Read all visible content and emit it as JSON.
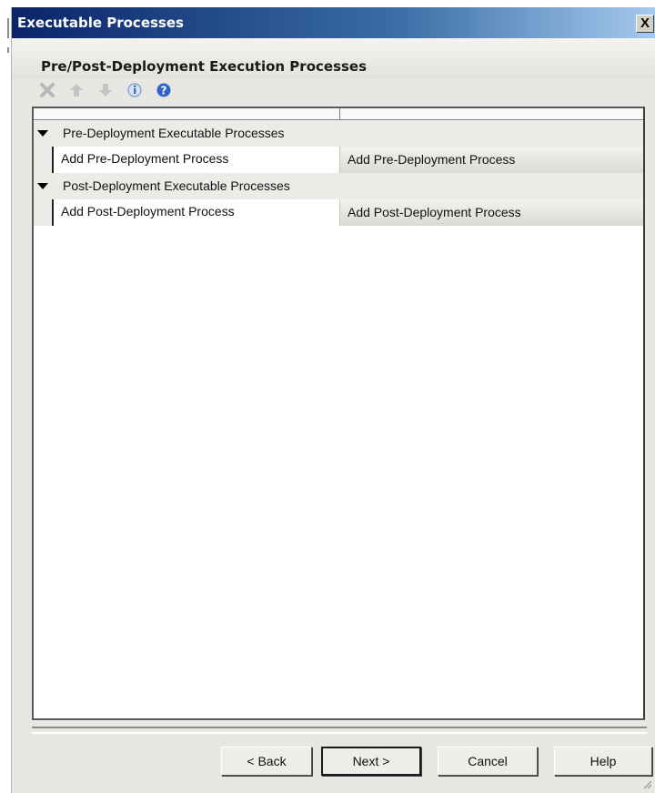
{
  "window": {
    "title": "Executable Processes",
    "close_glyph": "X"
  },
  "header": {
    "subtitle": "Pre/Post-Deployment Execution Processes"
  },
  "toolbar": {
    "icons": [
      "delete-icon",
      "move-up-icon",
      "move-down-icon",
      "info-icon",
      "help-icon"
    ]
  },
  "grid": {
    "categories": [
      {
        "label": "Pre-Deployment Executable Processes",
        "items": [
          {
            "name": "Add Pre-Deployment Process",
            "value": "Add Pre-Deployment Process"
          }
        ]
      },
      {
        "label": "Post-Deployment Executable Processes",
        "items": [
          {
            "name": "Add Post-Deployment Process",
            "value": "Add Post-Deployment Process"
          }
        ]
      }
    ]
  },
  "buttons": {
    "back": "< Back",
    "next": "Next >",
    "cancel": "Cancel",
    "help": "Help"
  }
}
